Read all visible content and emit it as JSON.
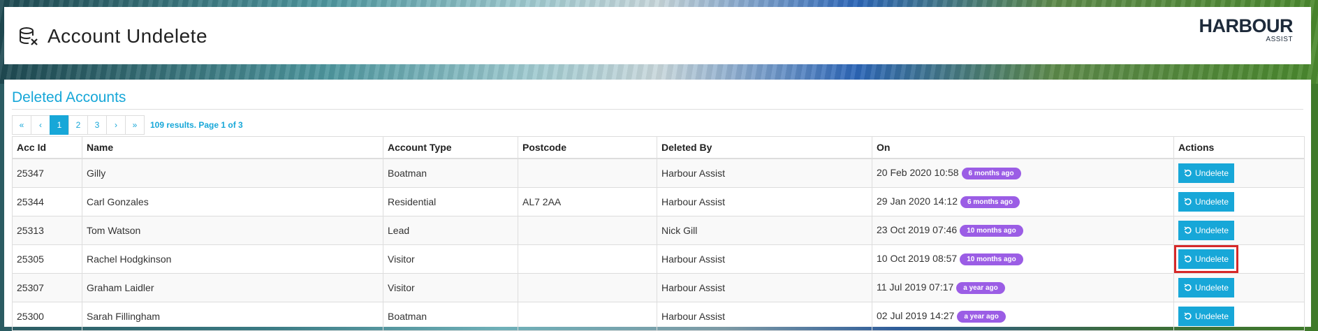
{
  "header": {
    "title": "Account Undelete",
    "logo_main": "HARBOUR",
    "logo_sub": "ASSIST"
  },
  "section": {
    "title": "Deleted Accounts"
  },
  "pagination": {
    "first": "«",
    "prev": "‹",
    "pages": [
      "1",
      "2",
      "3"
    ],
    "active_page": "1",
    "next": "›",
    "last": "»",
    "info": "109 results. Page 1 of 3"
  },
  "table": {
    "columns": [
      "Acc Id",
      "Name",
      "Account Type",
      "Postcode",
      "Deleted By",
      "On",
      "Actions"
    ],
    "rows": [
      {
        "id": "25347",
        "name": "Gilly",
        "type": "Boatman",
        "postcode": "",
        "deleted_by": "Harbour Assist",
        "on": "20 Feb 2020 10:58",
        "ago": "6 months ago",
        "action": "Undelete"
      },
      {
        "id": "25344",
        "name": "Carl Gonzales",
        "type": "Residential",
        "postcode": "AL7 2AA",
        "deleted_by": "Harbour Assist",
        "on": "29 Jan 2020 14:12",
        "ago": "6 months ago",
        "action": "Undelete"
      },
      {
        "id": "25313",
        "name": "Tom Watson",
        "type": "Lead",
        "postcode": "",
        "deleted_by": "Nick Gill",
        "on": "23 Oct 2019 07:46",
        "ago": "10 months ago",
        "action": "Undelete"
      },
      {
        "id": "25305",
        "name": "Rachel Hodgkinson",
        "type": "Visitor",
        "postcode": "",
        "deleted_by": "Harbour Assist",
        "on": "10 Oct 2019 08:57",
        "ago": "10 months ago",
        "action": "Undelete"
      },
      {
        "id": "25307",
        "name": "Graham Laidler",
        "type": "Visitor",
        "postcode": "",
        "deleted_by": "Harbour Assist",
        "on": "11 Jul 2019 07:17",
        "ago": "a year ago",
        "action": "Undelete"
      },
      {
        "id": "25300",
        "name": "Sarah Fillingham",
        "type": "Boatman",
        "postcode": "",
        "deleted_by": "Harbour Assist",
        "on": "02 Jul 2019 14:27",
        "ago": "a year ago",
        "action": "Undelete"
      }
    ]
  },
  "colors": {
    "accent": "#17a7d8",
    "badge": "#9b5de5",
    "highlight": "#d62828"
  },
  "icons": {
    "title": "database-remove-icon",
    "undelete": "undo-icon"
  }
}
